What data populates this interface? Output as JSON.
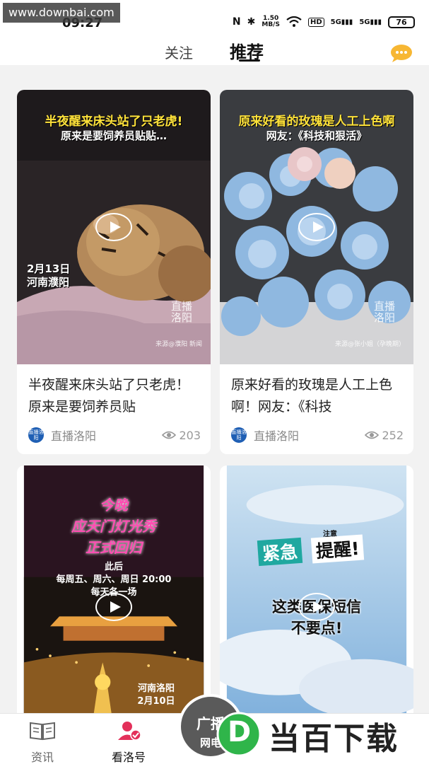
{
  "watermark_top": "www.downbai.com",
  "status_bar": {
    "time": "09:27",
    "net_speed_top": "1.50",
    "net_speed_bottom": "MB/S",
    "hd": "HD",
    "signal_1": "5G",
    "signal_2": "5G",
    "battery": "76"
  },
  "header": {
    "tabs": [
      {
        "label": "关注",
        "active": false
      },
      {
        "label": "推荐",
        "active": true
      }
    ]
  },
  "feed": [
    {
      "overlay_line_1": "半夜醒来床头站了只老虎!",
      "overlay_line_2": "原来是要饲养员贴贴…",
      "date_line_1": "2月13日",
      "date_line_2": "河南濮阳",
      "brand": "直播洛阳",
      "source": "来源@濮阳 新闻",
      "title": "半夜醒来床头站了只老虎！原来是要饲养员贴",
      "author": "直播洛阳",
      "avatar_text": "直播洛阳",
      "views": "203"
    },
    {
      "overlay_line_1": "原来好看的玫瑰是人工上色啊",
      "overlay_line_2": "网友：《科技和狠活》",
      "brand": "直播洛阳",
      "source": "来源@张小姐（孕晚期）",
      "title": "原来好看的玫瑰是人工上色啊！网友：《科技",
      "author": "直播洛阳",
      "avatar_text": "直播洛阳",
      "views": "252"
    },
    {
      "overlay_line_1": "今晚",
      "overlay_line_2": "应天门灯光秀",
      "overlay_line_3": "正式回归",
      "sub_1": "此后",
      "sub_2": "每周五、周六、周日 20:00",
      "sub_3": "每天各一场",
      "loc_1": "河南洛阳",
      "loc_2": "2月10日"
    },
    {
      "tag": "注意",
      "badge_1": "紧急",
      "badge_2": "提醒!",
      "overlay_line_1": "这类医保短信",
      "overlay_line_2": "不要点!"
    }
  ],
  "bottom_nav": {
    "items": [
      {
        "label": "资讯",
        "icon": "book-icon"
      },
      {
        "label": "看洛号",
        "icon": "person-check-icon"
      },
      {
        "label": "广播",
        "icon": "broadcast-icon"
      }
    ],
    "center_line_1": "广播",
    "center_line_2": "网电"
  },
  "site_logo": {
    "letter": "D",
    "text": "当百下载"
  },
  "colors": {
    "accent_yellow": "#ffe23a",
    "brand_blue": "#1f5fb4",
    "logo_green": "#2fb54a",
    "chat_orange": "#f7b733"
  }
}
